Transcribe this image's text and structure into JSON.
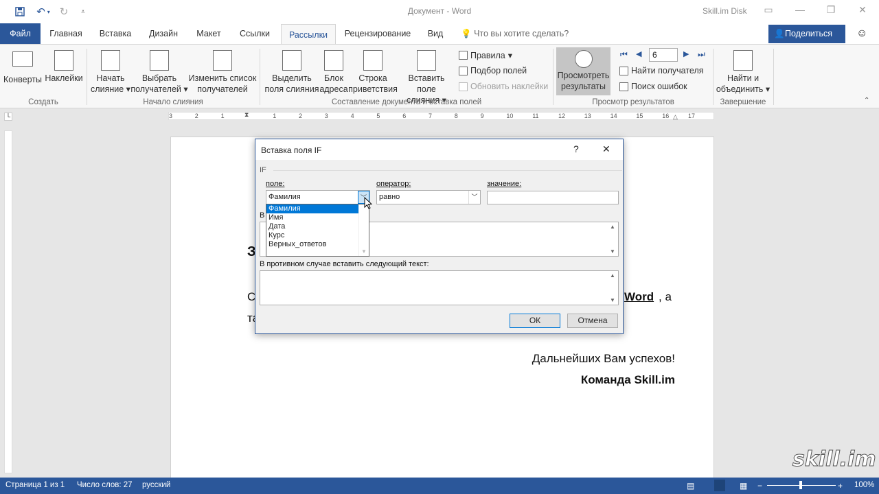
{
  "window": {
    "title": "Документ  -  Word",
    "account": "Skill.im Disk"
  },
  "tabs": [
    "Файл",
    "Главная",
    "Вставка",
    "Дизайн",
    "Макет",
    "Ссылки",
    "Рассылки",
    "Рецензирование",
    "Вид"
  ],
  "tell_me": "Что вы хотите сделать?",
  "share": "Поделиться",
  "ribbon": {
    "envelopes": "Конверты",
    "labels": "Наклейки",
    "group_create": "Создать",
    "start_merge_1": "Начать",
    "start_merge_2": "слияние",
    "select_recipients_1": "Выбрать",
    "select_recipients_2": "получателей",
    "edit_list_1": "Изменить список",
    "edit_list_2": "получателей",
    "group_start": "Начало слияния",
    "highlight_1": "Выделить",
    "highlight_2": "поля слияния",
    "address_1": "Блок",
    "address_2": "адреса",
    "greeting_1": "Строка",
    "greeting_2": "приветствия",
    "insert_field_1": "Вставить поле",
    "insert_field_2": "слияния",
    "rules": "Правила",
    "match_fields": "Подбор полей",
    "update_labels": "Обновить наклейки",
    "group_compose": "Составление документа и вставка полей",
    "preview_1": "Просмотреть",
    "preview_2": "результаты",
    "record": "6",
    "find_recipient": "Найти получателя",
    "check_errors": "Поиск ошибок",
    "group_preview": "Просмотр результатов",
    "finish_1": "Найти и",
    "finish_2": "объединить",
    "group_finish": "Завершение"
  },
  "ruler_numbers": [
    "3",
    "2",
    "1",
    "1",
    "2",
    "3",
    "4",
    "5",
    "6",
    "7",
    "8",
    "9",
    "10",
    "11",
    "12",
    "13",
    "14",
    "15",
    "16",
    "17"
  ],
  "document": {
    "heading_fragment": "З",
    "line1_start": "С",
    "word_bold": "Word",
    "line1_end": ", а",
    "line2_start": "та",
    "wishes": "Дальнейших Вам успехов!",
    "team": "Команда Skill.im"
  },
  "dialog": {
    "title": "Вставка поля IF",
    "help": "?",
    "close": "✕",
    "if_label": "IF",
    "field_label": "поле:",
    "field_value": "Фамилия",
    "operator_label": "оператор:",
    "operator_value": "равно",
    "value_label": "значение:",
    "value_value": "",
    "insert_label": "В",
    "else_label": "В противном случае вставить следующий текст:",
    "ok": "ОК",
    "cancel": "Отмена",
    "dropdown": [
      "Фамилия",
      "Имя",
      "Дата",
      "Курс",
      "Верных_ответов"
    ]
  },
  "status": {
    "page": "Страница 1 из 1",
    "words": "Число слов: 27",
    "language": "русский",
    "zoom": "100%"
  },
  "watermark": "skill.im"
}
